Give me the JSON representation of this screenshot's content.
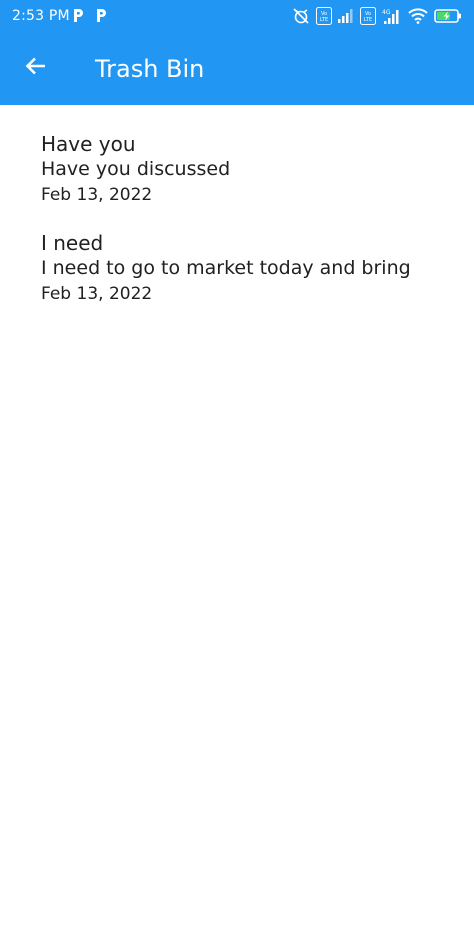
{
  "status_bar": {
    "time": "2:53 PM",
    "notification_icons": [
      "p-icon",
      "p-icon"
    ],
    "right_icons": [
      "alarm-off-icon",
      "volte-icon",
      "signal-icon",
      "volte-icon",
      "signal-icon",
      "wifi-icon",
      "battery-charging-icon"
    ]
  },
  "app_bar": {
    "title": "Trash Bin",
    "back_icon": "arrow-left-icon",
    "color": "#2196F3"
  },
  "notes": [
    {
      "title": "Have you",
      "body": "Have you discussed",
      "date": "Feb 13, 2022"
    },
    {
      "title": "I need",
      "body": "I need to go to market today and bring",
      "date": "Feb 13, 2022"
    }
  ]
}
